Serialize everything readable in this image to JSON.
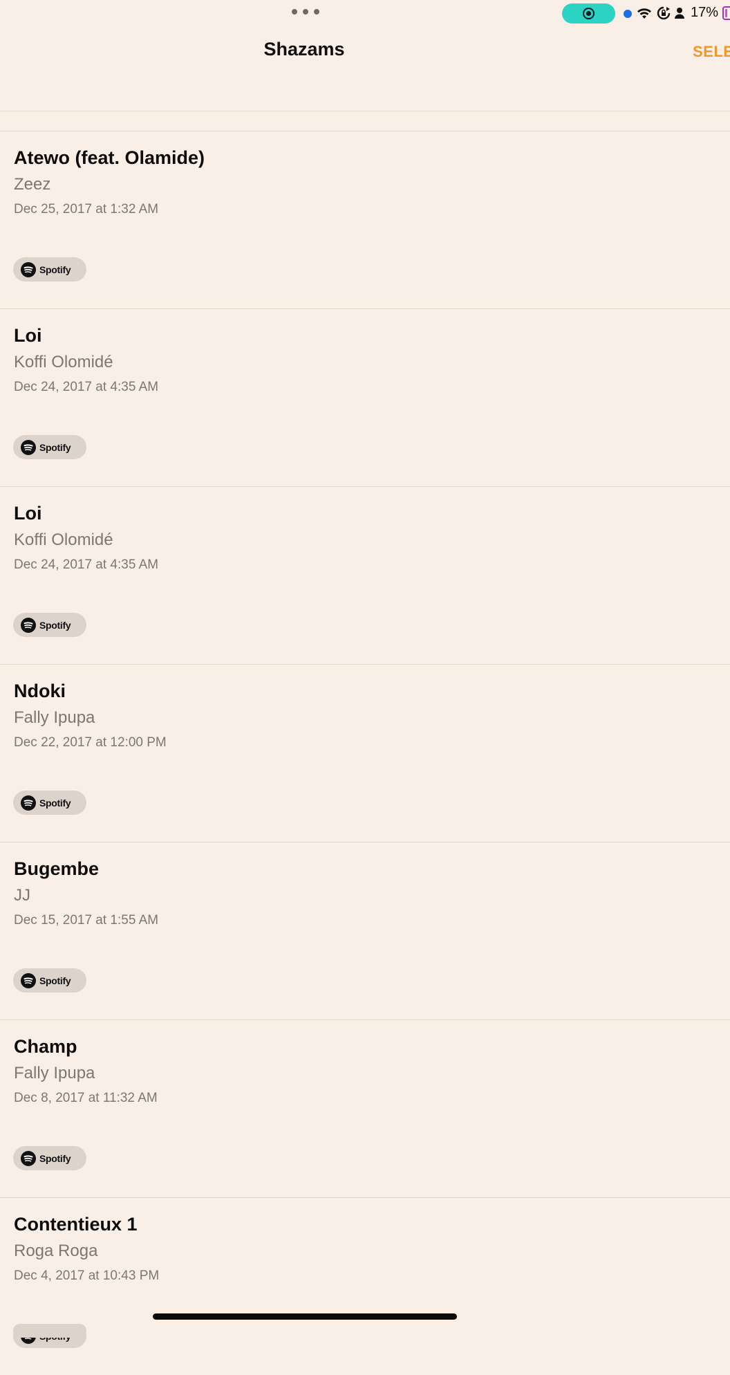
{
  "status_bar": {
    "battery_percent": "17%",
    "icons": [
      "more-dots-icon",
      "screen-record-icon",
      "location-dot-icon",
      "wifi-icon",
      "rotation-lock-icon",
      "person-icon",
      "battery-icon"
    ],
    "record_color": "#2bd3c4",
    "battery_color": "#a82fbf"
  },
  "nav": {
    "title": "Shazams",
    "select_label": "SELE",
    "accent_color": "#f0972a"
  },
  "items": [
    {
      "title": "Atewo (feat. Olamide)",
      "artist": "Zeez",
      "date": "Dec 25, 2017 at 1:32 AM",
      "button": "Spotify"
    },
    {
      "title": "Loi",
      "artist": "Koffi Olomidé",
      "date": "Dec 24, 2017 at 4:35 AM",
      "button": "Spotify"
    },
    {
      "title": "Loi",
      "artist": "Koffi Olomidé",
      "date": "Dec 24, 2017 at 4:35 AM",
      "button": "Spotify"
    },
    {
      "title": "Ndoki",
      "artist": "Fally Ipupa",
      "date": "Dec 22, 2017 at 12:00 PM",
      "button": "Spotify"
    },
    {
      "title": "Bugembe",
      "artist": "JJ",
      "date": "Dec 15, 2017 at 1:55 AM",
      "button": "Spotify"
    },
    {
      "title": "Champ",
      "artist": "Fally Ipupa",
      "date": "Dec 8, 2017 at 11:32 AM",
      "button": "Spotify"
    },
    {
      "title": "Contentieux 1",
      "artist": "Roga Roga",
      "date": "Dec 4, 2017 at 10:43 PM",
      "button": "Spotify"
    }
  ]
}
